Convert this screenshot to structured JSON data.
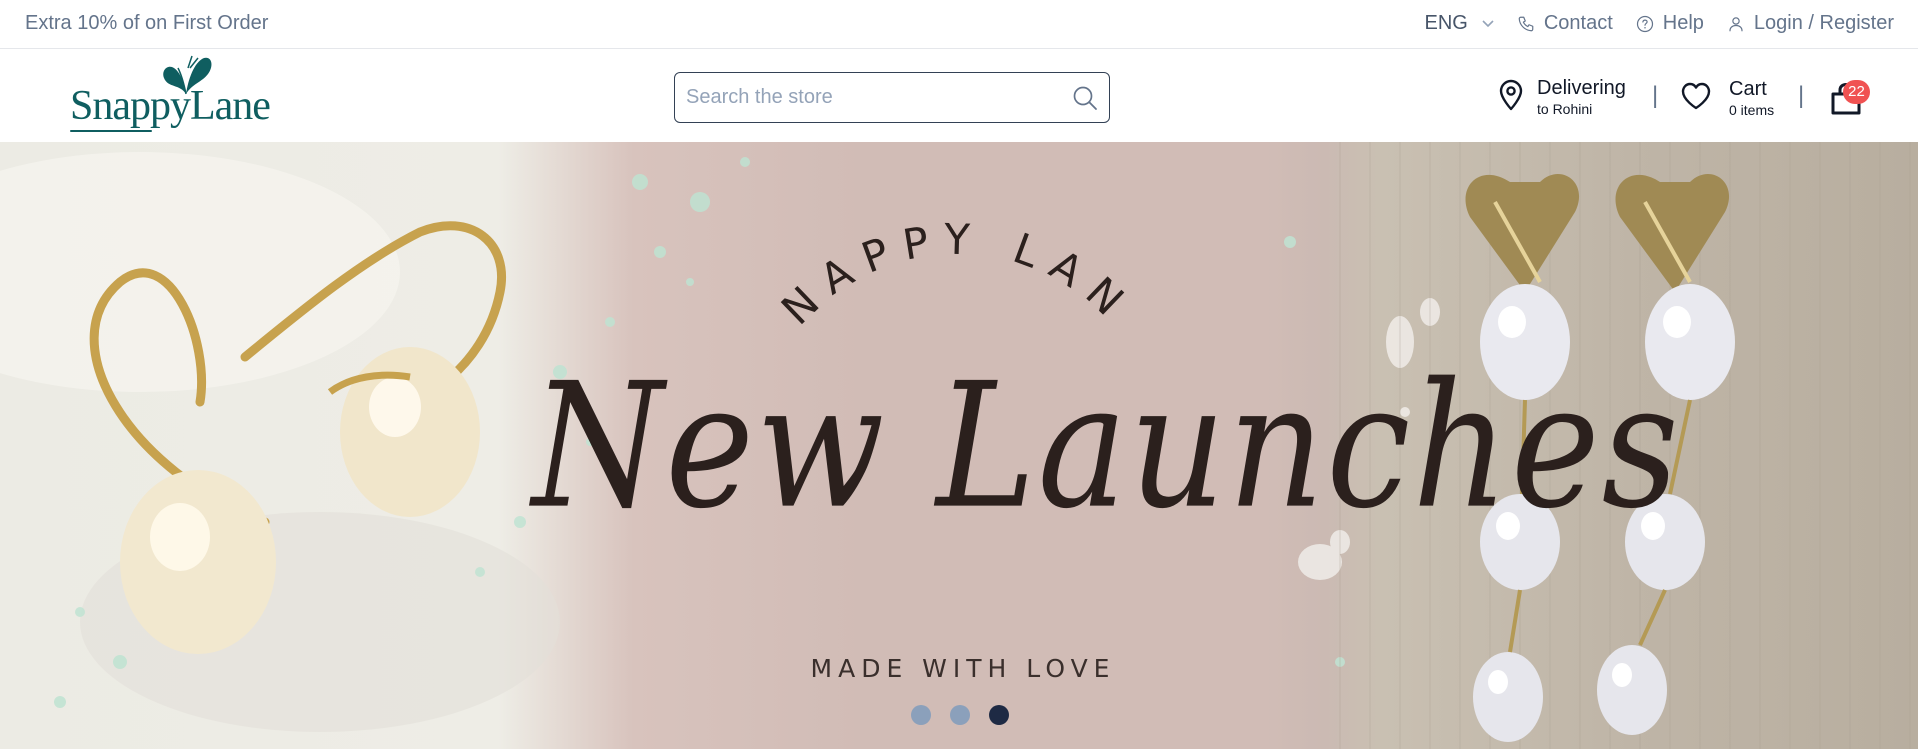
{
  "topbar": {
    "promo": "Extra 10% of on First Order",
    "language": "ENG",
    "contact": "Contact",
    "help": "Help",
    "login": "Login / Register"
  },
  "header": {
    "logo_text": "SnappyLane",
    "search": {
      "placeholder": "Search the store",
      "value": ""
    },
    "delivering": {
      "title": "Delivering",
      "location": "to Rohini"
    },
    "cart": {
      "title": "Cart",
      "items": "0 items"
    },
    "bag_count": "22"
  },
  "hero": {
    "brand": "SNAPPY LANE",
    "title": "New Launches",
    "subtitle": "MADE WITH LOVE",
    "slides": 3,
    "active_slide": 3
  },
  "icons": {
    "language": "chevron-down-icon",
    "contact": "phone-icon",
    "help": "question-circle-icon",
    "login": "user-icon",
    "search": "search-icon",
    "delivery": "location-pin-icon",
    "wishlist": "heart-icon",
    "bag": "shopping-bag-icon"
  },
  "colors": {
    "brand": "#0f5e60",
    "badge": "#f05252",
    "active_dot": "#1e2a44",
    "inactive_dot": "#8ba0bb"
  }
}
